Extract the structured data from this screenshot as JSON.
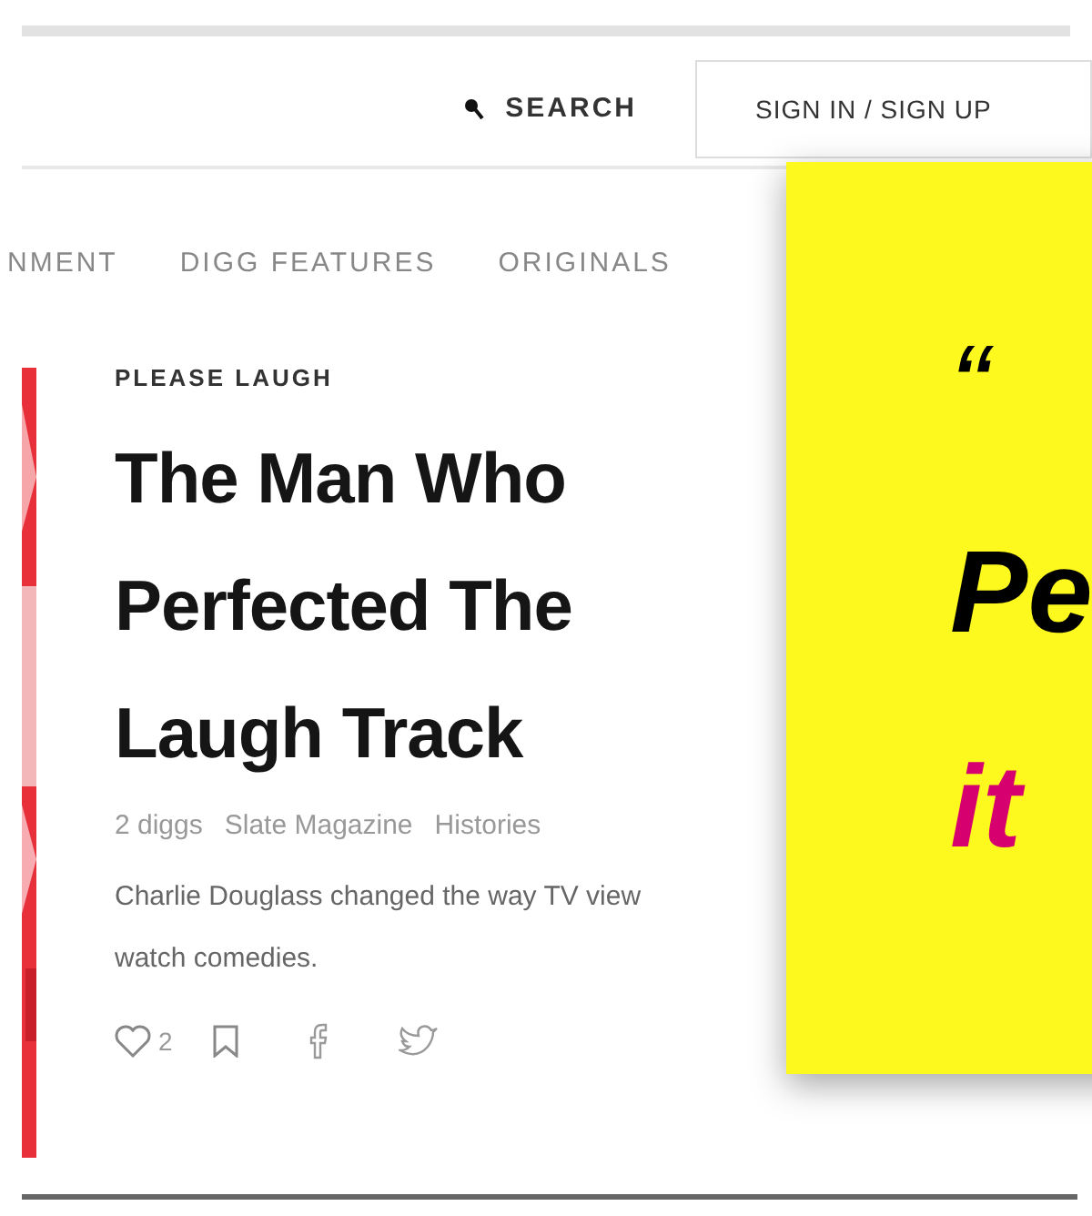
{
  "header": {
    "search_label": "SEARCH",
    "sign_in_button": "SIGN IN / SIGN UP"
  },
  "nav": {
    "items": [
      {
        "label": "NMENT"
      },
      {
        "label": "DIGG FEATURES"
      },
      {
        "label": "ORIGINALS"
      }
    ]
  },
  "article": {
    "kicker": "PLEASE LAUGH",
    "headline_lines": [
      "The Man Who",
      "Perfected The",
      "Laugh Track"
    ],
    "meta": [
      "2 diggs",
      "Slate Magazine",
      "Histories"
    ],
    "description_lines": [
      "Charlie Douglass changed the way TV view",
      "watch comedies."
    ],
    "digg_count": "2"
  },
  "overlay_card": {
    "lines": [
      {
        "text": "“",
        "kind": "plain"
      },
      {
        "text": "Pe",
        "kind": "bold"
      },
      {
        "text": "it",
        "kind": "accent"
      }
    ]
  }
}
